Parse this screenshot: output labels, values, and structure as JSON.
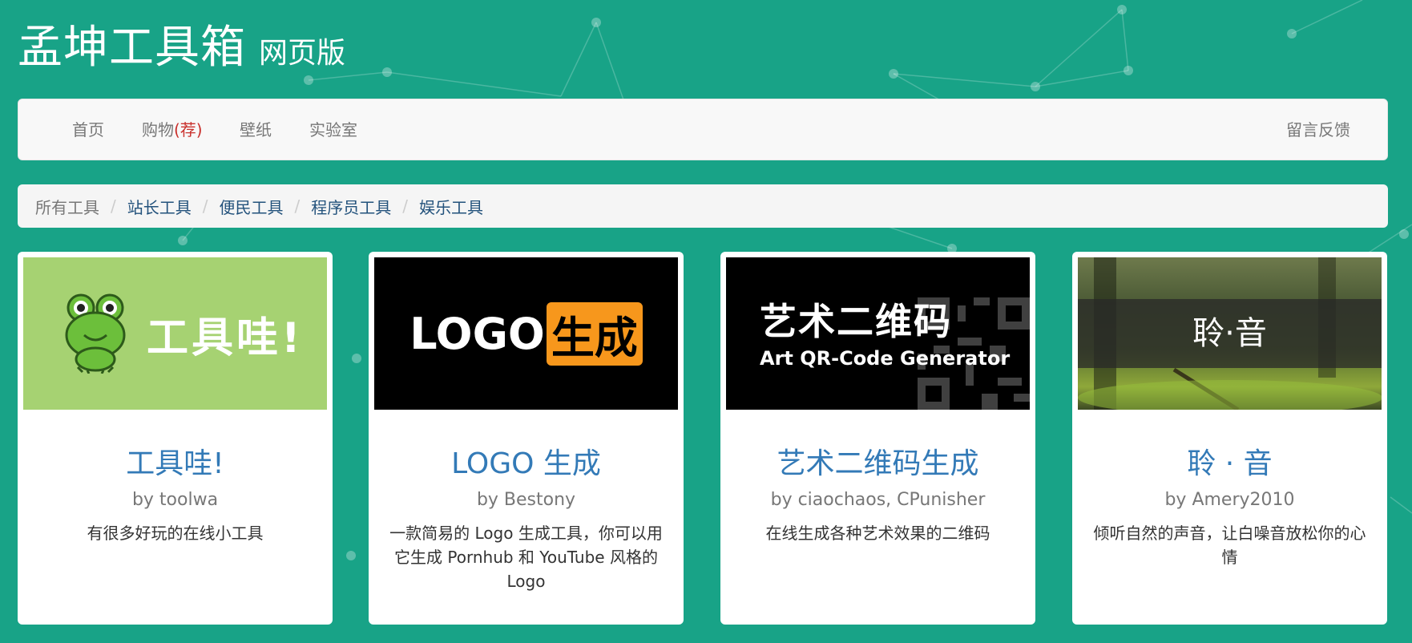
{
  "header": {
    "title": "孟坤工具箱",
    "subtitle": "网页版"
  },
  "nav": {
    "home": "首页",
    "shop": "购物",
    "shop_badge": "(荐)",
    "wallpaper": "壁纸",
    "lab": "实验室",
    "feedback": "留言反馈"
  },
  "breadcrumb": {
    "all": "所有工具",
    "items": [
      "站长工具",
      "便民工具",
      "程序员工具",
      "娱乐工具"
    ]
  },
  "cards": [
    {
      "title": "工具哇!",
      "author": "by toolwa",
      "desc": "有很多好玩的在线小工具",
      "thumb_text": "工具哇!",
      "thumb_icon": "frog-icon",
      "thumb_color": "#a6d272"
    },
    {
      "title": "LOGO 生成",
      "author": "by Bestony",
      "desc": "一款简易的 Logo 生成工具，你可以用它生成 Pornhub 和 YouTube 风格的 Logo",
      "thumb_text_a": "LOGO",
      "thumb_text_b": "生成",
      "accent": "#f7971c"
    },
    {
      "title": "艺术二维码生成",
      "author": "by ciaochaos, CPunisher",
      "desc": "在线生成各种艺术效果的二维码",
      "thumb_text_cn": "艺术二维码",
      "thumb_text_en": "Art QR-Code Generator",
      "thumb_icon": "qr-code-icon"
    },
    {
      "title": "聆 · 音",
      "author": "by Amery2010",
      "desc": "倾听自然的声音，让白噪音放松你的心情",
      "thumb_text": "聆·音"
    }
  ],
  "colors": {
    "background": "#18a387",
    "link": "#337ab7",
    "recommend": "#c9302c"
  }
}
